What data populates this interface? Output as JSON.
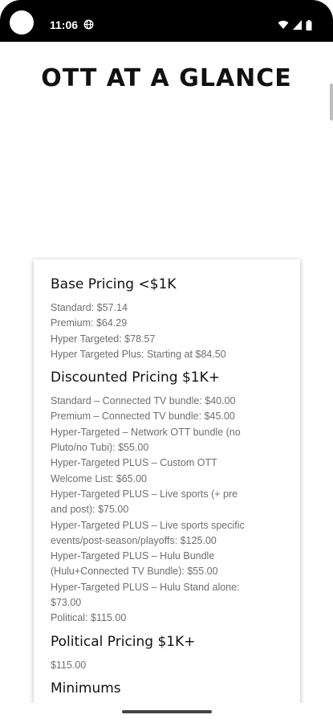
{
  "status_bar": {
    "time": "11:06",
    "icons": [
      "camera-cutout",
      "globe-icon",
      "wifi-icon",
      "signal-icon",
      "battery-icon"
    ]
  },
  "page": {
    "title": "OTT AT A GLANCE"
  },
  "sections": {
    "base": {
      "heading": "Base Pricing <$1K",
      "lines": [
        "Standard: $57.14",
        "Premium: $64.29",
        "Hyper Targeted: $78.57",
        "Hyper Targeted Plus: Starting at $84.50"
      ]
    },
    "discounted": {
      "heading": "Discounted Pricing $1K+",
      "lines": [
        "Standard –  Connected TV bundle: $40.00",
        "Premium –  Connected TV bundle: $45.00",
        "Hyper-Targeted –  Network OTT bundle (no",
        "Pluto/no Tubi): $55.00",
        "Hyper-Targeted PLUS –  Custom OTT",
        "Welcome List: $65.00",
        "Hyper-Targeted PLUS –  Live sports (+ pre",
        "and post): $75.00",
        "Hyper-Targeted PLUS –  Live sports specific",
        "events/post-season/playoffs: $125.00",
        "Hyper-Targeted PLUS –  Hulu Bundle",
        "(Hulu+Connected TV Bundle): $55.00",
        "Hyper-Targeted PLUS –  Hulu Stand alone:",
        "$73.00",
        "Political: $115.00"
      ]
    },
    "political": {
      "heading": "Political Pricing $1K+",
      "lines": [
        "$115.00"
      ]
    },
    "minimums": {
      "heading": "Minimums"
    }
  }
}
